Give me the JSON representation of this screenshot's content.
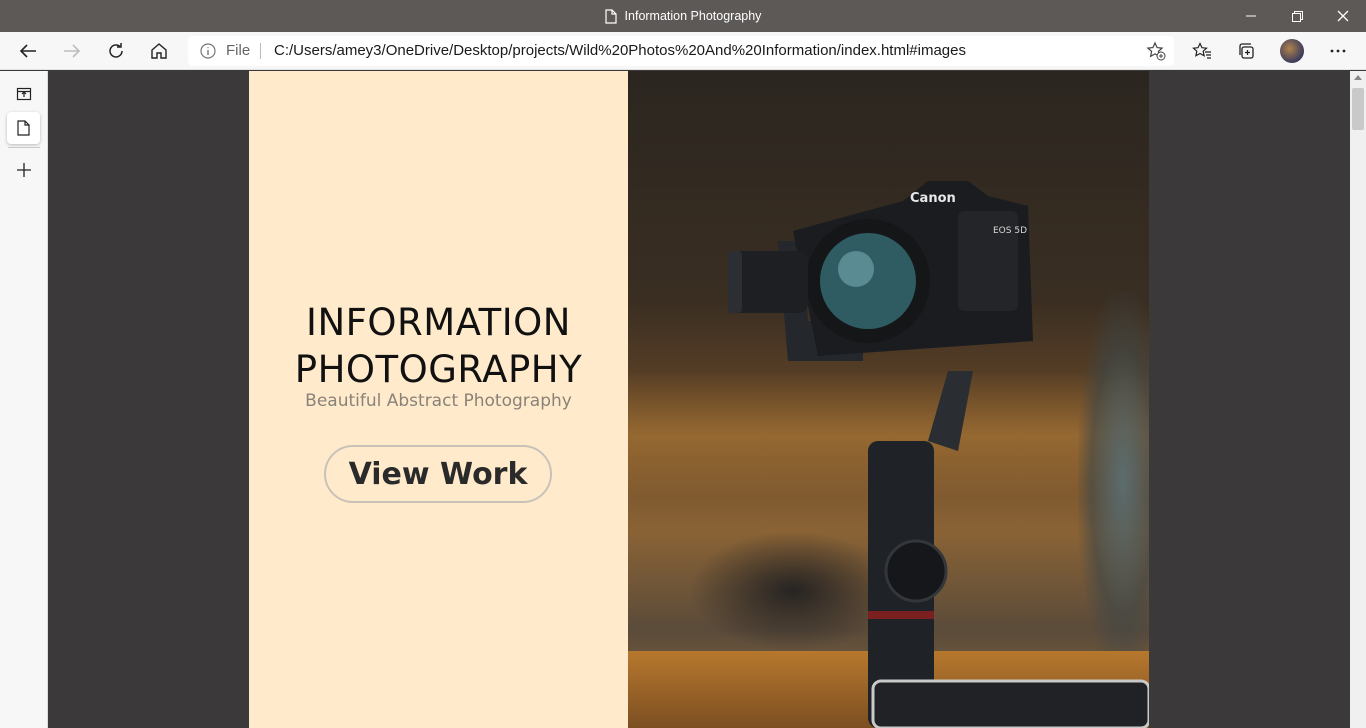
{
  "window": {
    "title": "Information Photography"
  },
  "address_bar": {
    "scheme_label": "File",
    "url": "C:/Users/amey3/OneDrive/Desktop/projects/Wild%20Photos%20And%20Information/index.html#images"
  },
  "page": {
    "title_line1": "INFORMATION",
    "title_line2": "PHOTOGRAPHY",
    "subtitle": "Beautiful Abstract Photography",
    "cta_label": "View Work",
    "photo_brand": "Canon",
    "photo_model": "EOS 5D"
  },
  "colors": {
    "hero_panel": "#ffebcc",
    "page_background": "#3b3939",
    "titlebar": "#5c5957"
  },
  "icons": {
    "toolbar": [
      "back-icon",
      "forward-icon",
      "refresh-icon",
      "home-icon",
      "info-icon",
      "add-favorite-icon",
      "favorites-icon",
      "collections-icon",
      "more-icon"
    ],
    "sidebar": [
      "tab-actions-icon",
      "page-icon",
      "new-tab-icon"
    ]
  }
}
